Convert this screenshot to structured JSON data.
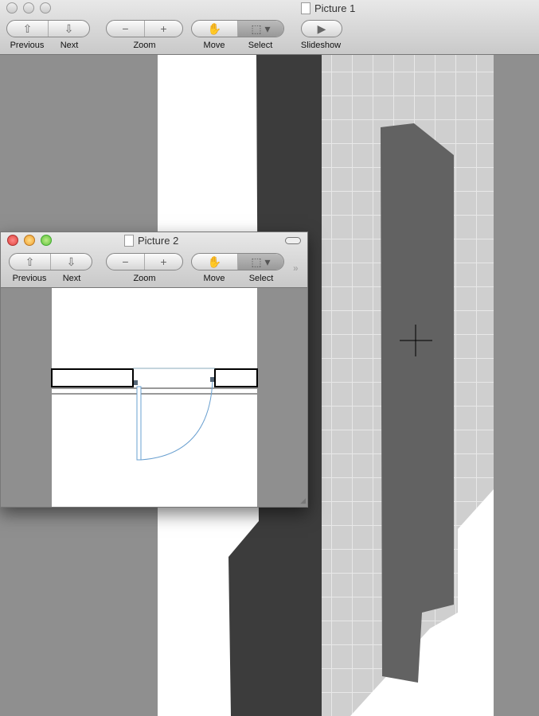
{
  "main_window": {
    "title": "Picture 1",
    "toolbar": {
      "previous": "Previous",
      "next": "Next",
      "zoom": "Zoom",
      "move": "Move",
      "select": "Select",
      "slideshow": "Slideshow"
    }
  },
  "inspector_window": {
    "title": "Picture 2",
    "toolbar": {
      "previous": "Previous",
      "next": "Next",
      "zoom": "Zoom",
      "move": "Move",
      "select": "Select"
    }
  },
  "colors": {
    "close": "#e0443e",
    "minimize": "#f0a030",
    "zoom": "#5fbf3a"
  }
}
